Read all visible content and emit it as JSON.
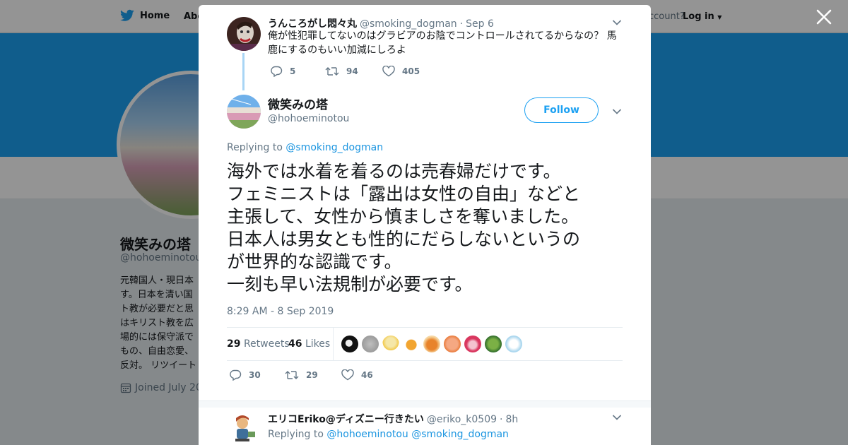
{
  "topnav": {
    "home": "Home",
    "about": "Abo",
    "account_prefix": "ccount?",
    "login": "Log in"
  },
  "profile": {
    "name": "微笑みの塔",
    "handle": "@hohoeminotou",
    "bio_lines": [
      "元韓国人・現日本",
      "す。日本を清い国",
      "ト教が必要だと思",
      "はキリスト教を広",
      "場的には保守派で",
      "もの、自由恋愛、",
      "反対。 リツイート"
    ],
    "joined": "Joined July 20"
  },
  "parent_tweet": {
    "name": "うんころがし悶々丸",
    "handle": "@smoking_dogman",
    "time": "Sep 6",
    "text_lines": [
      "俺が性犯罪してないのはグラビアのお陰でコントロールされてるからなの？ 馬",
      "鹿にするのもいい加減にしろよ"
    ],
    "replies": "5",
    "retweets": "94",
    "likes": "405"
  },
  "main_tweet": {
    "name": "微笑みの塔",
    "handle": "@hohoeminotou",
    "follow_label": "Follow",
    "replying_prefix": "Replying to",
    "replying_to": "@smoking_dogman",
    "text_lines": [
      "海外では水着を着るのは売春婦だけです。",
      "フェミニストは「露出は女性の自由」などと",
      "主張して、女性から慎ましさを奪いました。",
      "日本人は男女とも性的にだらしないというの",
      "が世界的な認識です。",
      "一刻も早い法規制が必要です。"
    ],
    "timestamp": "8:29 AM - 8 Sep 2019",
    "retweets_count": "29",
    "retweets_label": "Retweets",
    "likes_count": "46",
    "likes_label": "Likes",
    "replies": "30",
    "retweets": "29",
    "likes": "46"
  },
  "reply_tweet": {
    "name": "エリコEriko@ディズニー行きたい",
    "handle": "@eriko_k0509",
    "time": "8h",
    "replying_prefix": "Replying to",
    "mention1": "@hohoeminotou",
    "mention2": "@smoking_dogman"
  },
  "colors": {
    "accent": "#1da1f2",
    "link": "#1b95e0",
    "muted": "#657786",
    "text": "#14171a"
  }
}
